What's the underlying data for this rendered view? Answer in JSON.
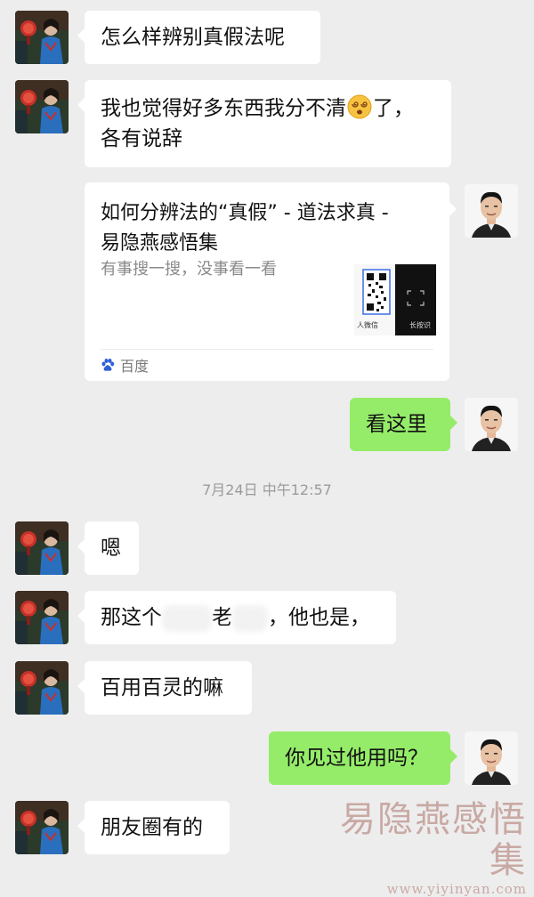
{
  "messages": [
    {
      "side": "left",
      "text": "怎么样辨别真假法呢"
    },
    {
      "side": "left",
      "line1": "我也觉得好多东西我分不清",
      "line1_end": "了，",
      "line2": "各有说辞",
      "emoji": "dizzy-face"
    },
    {
      "side": "right",
      "type": "link-card",
      "title_line1": "如何分辨法的“真假” - 道法求真 -",
      "title_line2": "易隐燕感悟集",
      "description": "有事搜一搜，没事看一看",
      "thumb_left_text": "人微信",
      "thumb_right_text": "长按识",
      "source": "百度"
    },
    {
      "side": "right",
      "text": "看这里"
    },
    {
      "type": "timestamp",
      "text": "7月24日 中午12:57"
    },
    {
      "side": "left",
      "text": "嗯"
    },
    {
      "side": "left",
      "part1": "那这个",
      "part2": "老",
      "part3": "，他也是，"
    },
    {
      "side": "left",
      "text": "百用百灵的嘛"
    },
    {
      "side": "right",
      "text": "你见过他用吗？"
    },
    {
      "side": "left",
      "text": "朋友圈有的"
    }
  ],
  "watermark": {
    "text": "易隐燕感悟集",
    "url": "www.yiyinyan.com"
  },
  "colors": {
    "background": "#ededed",
    "bubble_left": "#ffffff",
    "bubble_right": "#95ec69",
    "timestamp": "#9b9b9b",
    "watermark": "#c9a9a4"
  }
}
